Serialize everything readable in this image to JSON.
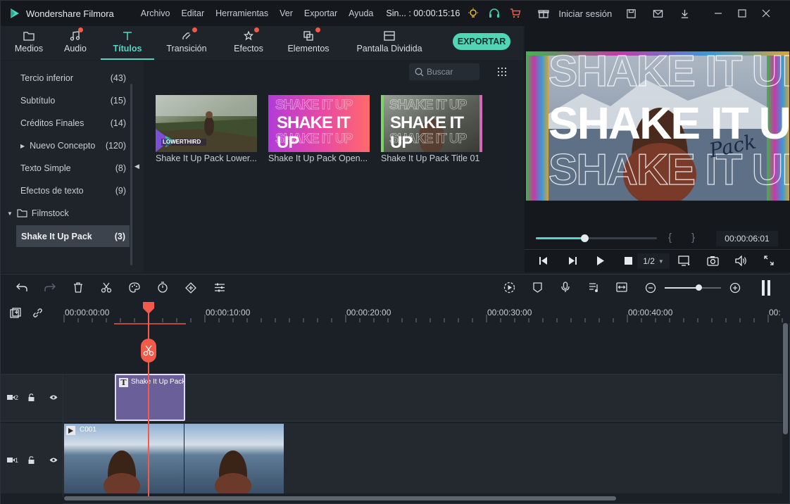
{
  "app": {
    "name": "Wondershare Filmora",
    "project": "Sin... : 00:00:15:16"
  },
  "menu": [
    "Archivo",
    "Editar",
    "Herramientas",
    "Ver",
    "Exportar",
    "Ayuda"
  ],
  "account": {
    "signin_label": "Iniciar sesión"
  },
  "tabs": [
    {
      "label": "Medios",
      "icon": "folder-icon",
      "dot": false
    },
    {
      "label": "Audio",
      "icon": "music-note-icon",
      "dot": true
    },
    {
      "label": "Títulos",
      "icon": "title-t-icon",
      "dot": false,
      "active": true
    },
    {
      "label": "Transición",
      "icon": "transition-icon",
      "dot": true
    },
    {
      "label": "Efectos",
      "icon": "effects-icon",
      "dot": true
    },
    {
      "label": "Elementos",
      "icon": "elements-icon",
      "dot": true
    },
    {
      "label": "Pantalla Dividida",
      "icon": "split-screen-icon",
      "dot": false
    }
  ],
  "export_label": "EXPORTAR",
  "sidebar": {
    "items": [
      {
        "label": "Tercio inferior",
        "count": "(43)"
      },
      {
        "label": "Subtítulo",
        "count": "(15)"
      },
      {
        "label": "Créditos Finales",
        "count": "(14)"
      },
      {
        "label": "Nuevo Concepto",
        "count": "(120)"
      },
      {
        "label": "Texto Simple",
        "count": "(8)"
      },
      {
        "label": "Efectos de texto",
        "count": "(9)"
      }
    ],
    "folder": "Filmstock",
    "selected": {
      "label": "Shake It Up Pack",
      "count": "(3)"
    }
  },
  "search": {
    "placeholder": "Buscar"
  },
  "library": {
    "items": [
      {
        "caption": "Shake It Up Pack Lower...",
        "overlay": "LOWERTHIRD"
      },
      {
        "caption": "Shake It Up Pack Open...",
        "overlay": "SHAKE IT UP"
      },
      {
        "caption": "Shake It Up Pack Title 01",
        "overlay": "SHAKE IT UP"
      }
    ]
  },
  "preview": {
    "title_main": "SHAKE IT UP",
    "title_script": "Pack",
    "time": "00:00:06:01",
    "quality": "1/2",
    "progress": 0.4,
    "bracket_left": "{",
    "bracket_right": "}"
  },
  "timeline": {
    "ticks": [
      "00:00:00:00",
      "00:00:10:00",
      "00:00:20:00",
      "00:00:30:00",
      "00:00:40:00",
      "00:"
    ],
    "zoom_level": 0.6,
    "tracks": [
      {
        "number": "2",
        "clip": "Shake It Up Pack"
      },
      {
        "number": "1",
        "clip": "C001"
      }
    ]
  },
  "colors": {
    "accent": "#55d6c3",
    "export": "#4fd6b4",
    "playhead": "#f35a4a",
    "title_clip": "#6a5f98"
  }
}
